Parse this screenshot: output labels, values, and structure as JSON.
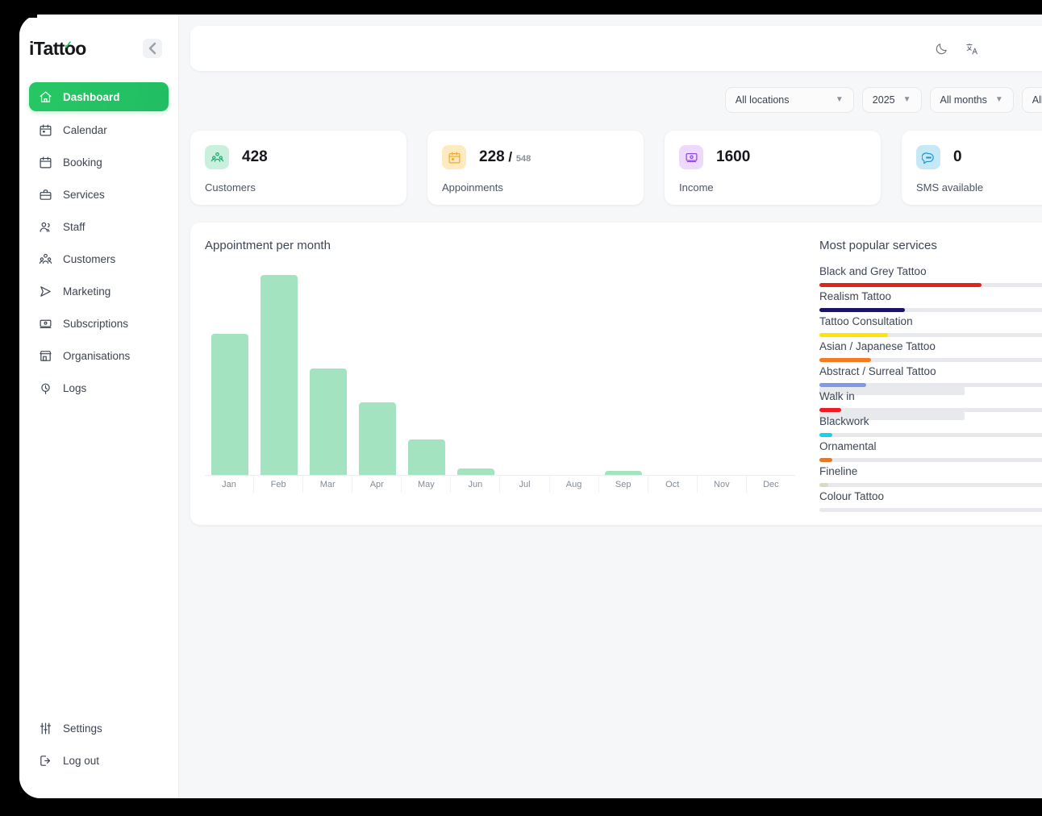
{
  "brand": {
    "name": "iTattoo",
    "accent": "#22c55e"
  },
  "sidebar": {
    "collapse_icon": "chevron-left-icon",
    "items": [
      {
        "label": "Dashboard",
        "icon": "home-icon",
        "active": true
      },
      {
        "label": "Calendar",
        "icon": "calendar-days-icon",
        "active": false
      },
      {
        "label": "Booking",
        "icon": "calendar-icon",
        "active": false
      },
      {
        "label": "Services",
        "icon": "briefcase-icon",
        "active": false
      },
      {
        "label": "Staff",
        "icon": "users-icon",
        "active": false
      },
      {
        "label": "Customers",
        "icon": "user-group-icon",
        "active": false
      },
      {
        "label": "Marketing",
        "icon": "send-icon",
        "active": false
      },
      {
        "label": "Subscriptions",
        "icon": "card-icon",
        "active": false
      },
      {
        "label": "Organisations",
        "icon": "store-icon",
        "active": false
      },
      {
        "label": "Logs",
        "icon": "activity-icon",
        "active": false
      }
    ],
    "bottom_items": [
      {
        "label": "Settings",
        "icon": "sliders-icon"
      },
      {
        "label": "Log out",
        "icon": "logout-icon"
      }
    ]
  },
  "topbar": {
    "icons": [
      {
        "name": "dark-mode-moon-icon"
      },
      {
        "name": "translate-language-icon"
      }
    ]
  },
  "filters": [
    {
      "label": "All locations",
      "has_chevron": true,
      "wide": true
    },
    {
      "label": "2025",
      "has_chevron": true,
      "wide": false
    },
    {
      "label": "All months",
      "has_chevron": true,
      "wide": false
    },
    {
      "label": "All services",
      "has_chevron": false,
      "wide": false
    }
  ],
  "stat_cards": [
    {
      "value": "428",
      "secondary": "",
      "label": "Customers",
      "icon": "user-group-icon",
      "icon_bg": "#c8f0dc",
      "icon_color": "#22a06b"
    },
    {
      "value": "228",
      "secondary": "548",
      "label": "Appoinments",
      "icon": "calendar-days-icon",
      "icon_bg": "#fdeac0",
      "icon_color": "#f0a92b"
    },
    {
      "value": "1600",
      "secondary": "",
      "label": "Income",
      "icon": "money-icon",
      "icon_bg": "#ecd9fb",
      "icon_color": "#8b45dd"
    },
    {
      "value": "0",
      "secondary": "",
      "label": "SMS available",
      "icon": "chat-bubble-icon",
      "icon_bg": "#c6e9f7",
      "icon_color": "#2196d1"
    }
  ],
  "chart_data": {
    "type": "bar",
    "title": "Appointment per month",
    "xlabel": "",
    "ylabel": "",
    "categories": [
      "Jan",
      "Feb",
      "Mar",
      "Apr",
      "May",
      "Jun",
      "Jul",
      "Aug",
      "Sep",
      "Oct",
      "Nov",
      "Dec"
    ],
    "values": [
      68,
      96,
      51,
      35,
      17,
      3,
      0,
      0,
      2,
      0,
      0,
      0
    ],
    "ylim": [
      0,
      100
    ],
    "grid": false,
    "bar_color": "#a3e3c0",
    "legend": "none"
  },
  "services": {
    "title": "Most popular services",
    "items": [
      {
        "name": "Black and Grey Tattoo",
        "color": "#e0251b",
        "fill_pct": 38,
        "ghost_pct": 0
      },
      {
        "name": "Realism Tattoo",
        "color": "#1b1464",
        "fill_pct": 20,
        "ghost_pct": 0
      },
      {
        "name": "Tattoo Consultation",
        "color": "#ffe500",
        "fill_pct": 16,
        "ghost_pct": 0
      },
      {
        "name": "Asian / Japanese Tattoo",
        "color": "#f47b20",
        "fill_pct": 12,
        "ghost_pct": 0
      },
      {
        "name": "Abstract / Surreal Tattoo",
        "color": "#7e99e8",
        "fill_pct": 11,
        "ghost_pct": 0
      },
      {
        "name": "Walk in",
        "color": "#ed1c24",
        "fill_pct": 5,
        "ghost_pct": 34
      },
      {
        "name": "Blackwork",
        "color": "#18d2e6",
        "fill_pct": 3,
        "ghost_pct": 34
      },
      {
        "name": "Ornamental",
        "color": "#e07b2a",
        "fill_pct": 3,
        "ghost_pct": 0
      },
      {
        "name": "Fineline",
        "color": "#ded8c6",
        "fill_pct": 2,
        "ghost_pct": 0
      },
      {
        "name": "Colour Tattoo",
        "color": "#e7e9ec",
        "fill_pct": 0,
        "ghost_pct": 0
      }
    ]
  }
}
